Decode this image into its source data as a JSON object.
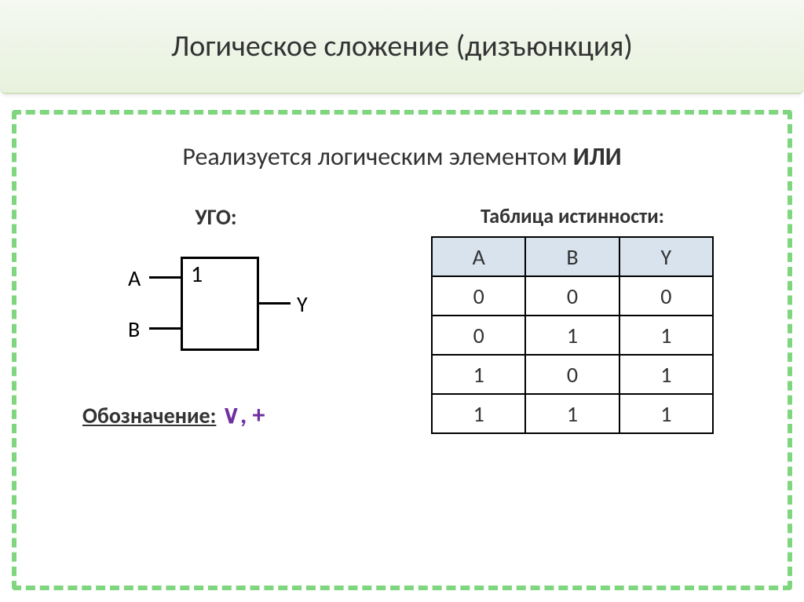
{
  "header": {
    "title": "Логическое сложение (дизъюнкция)"
  },
  "subtitle": {
    "text": "Реализуется логическим элементом ",
    "bold": "ИЛИ"
  },
  "ugo": {
    "label": "УГО:",
    "gate_symbol": "1",
    "input_a": "A",
    "input_b": "B",
    "output": "Y"
  },
  "notation": {
    "label": "Обозначение:",
    "symbols": " ∨, +"
  },
  "truth_table": {
    "title": "Таблица истинности:",
    "headers": [
      "A",
      "B",
      "Y"
    ],
    "rows": [
      [
        "0",
        "0",
        "0"
      ],
      [
        "0",
        "1",
        "1"
      ],
      [
        "1",
        "0",
        "1"
      ],
      [
        "1",
        "1",
        "1"
      ]
    ]
  },
  "chart_data": {
    "type": "table",
    "title": "Таблица истинности (OR gate / дизъюнкция)",
    "columns": [
      "A",
      "B",
      "Y"
    ],
    "data": [
      {
        "A": 0,
        "B": 0,
        "Y": 0
      },
      {
        "A": 0,
        "B": 1,
        "Y": 1
      },
      {
        "A": 1,
        "B": 0,
        "Y": 1
      },
      {
        "A": 1,
        "B": 1,
        "Y": 1
      }
    ],
    "operation": "disjunction (OR)",
    "notation": [
      "∨",
      "+"
    ]
  }
}
